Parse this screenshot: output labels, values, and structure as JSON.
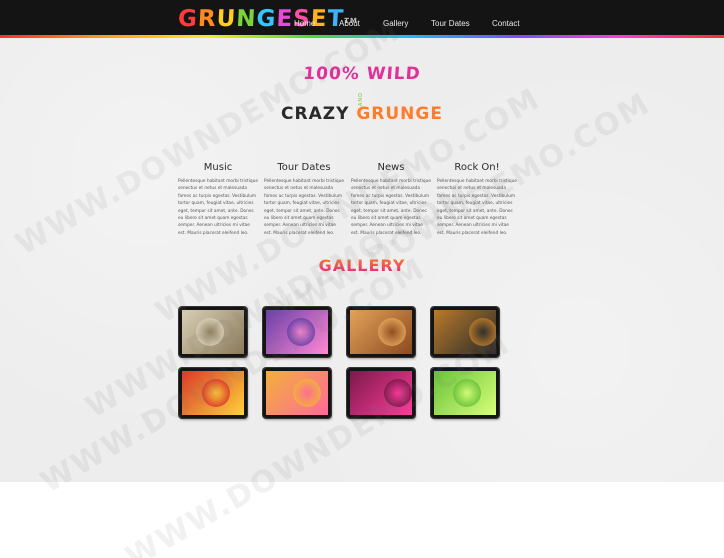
{
  "header": {
    "logo": {
      "letters": [
        {
          "ch": "G",
          "color": "#ff3b3b"
        },
        {
          "ch": "R",
          "color": "#ff8a1f"
        },
        {
          "ch": "U",
          "color": "#ffcf1f"
        },
        {
          "ch": "N",
          "color": "#7bd43a"
        },
        {
          "ch": "G",
          "color": "#35c6ff"
        },
        {
          "ch": "E",
          "color": "#e94ad9"
        },
        {
          "ch": "S",
          "color": "#ff4fa3"
        },
        {
          "ch": "E",
          "color": "#ffb21f"
        },
        {
          "ch": "T",
          "color": "#3db3ff"
        }
      ],
      "mark": "TM"
    },
    "nav": [
      "Home",
      "About",
      "Gallery",
      "Tour Dates",
      "Contact"
    ]
  },
  "hero": {
    "line1": "100% WILD",
    "and": "AND",
    "line2_a": "CRAZY",
    "line2_b": "GRUNGE"
  },
  "columns": [
    {
      "title": "Music",
      "body": "Pellentesque habitant morbi tristique senectus et netus et malesuada fames ac turpis egestas. Vestibulum tortor quam, feugiat vitae, ultricies eget, tempor sit amet, ante. Donec eu libero sit amet quam egestas semper. Aenean ultricies mi vitae est. Mauris placerat eleifend leo."
    },
    {
      "title": "Tour Dates",
      "body": "Pellentesque habitant morbi tristique senectus et netus et malesuada fames ac turpis egestas. Vestibulum tortor quam, feugiat vitae, ultricies eget, tempor sit amet, ante. Donec eu libero sit amet quam egestas semper. Aenean ultricies mi vitae est. Mauris placerat eleifend leo."
    },
    {
      "title": "News",
      "body": "Pellentesque habitant morbi tristique senectus et netus et malesuada fames ac turpis egestas. Vestibulum tortor quam, feugiat vitae, ultricies eget, tempor sit amet, ante. Donec eu libero sit amet quam egestas semper. Aenean ultricies mi vitae est. Mauris placerat eleifend leo."
    },
    {
      "title": "Rock On!",
      "body": "Pellentesque habitant morbi tristique senectus et netus et malesuada fames ac turpis egestas. Vestibulum tortor quam, feugiat vitae, ultricies eget, tempor sit amet, ante. Donec eu libero sit amet quam egestas semper. Aenean ultricies mi vitae est. Mauris placerat eleifend leo."
    }
  ],
  "gallery": {
    "title": "GALLERY",
    "thumbs": [
      {
        "name": "turntable-photo",
        "bg": "#d9cfb6",
        "accent": "#8a7a5a"
      },
      {
        "name": "pink-girl-photo",
        "bg": "#6a3ea8",
        "accent": "#ff8ad4"
      },
      {
        "name": "desert-figure-photo",
        "bg": "#e3a35a",
        "accent": "#8b4a1f"
      },
      {
        "name": "dj-photo",
        "bg": "#b97a2a",
        "accent": "#2a2a2a"
      },
      {
        "name": "skull-art-photo",
        "bg": "#d83a2a",
        "accent": "#ffd23a"
      },
      {
        "name": "butterfly-girl-photo",
        "bg": "#f2b03a",
        "accent": "#ff6a9a"
      },
      {
        "name": "vinyl-art-photo",
        "bg": "#7a1a4a",
        "accent": "#ff3b9a"
      },
      {
        "name": "green-abstract-photo",
        "bg": "#6ac23a",
        "accent": "#d8ff7a"
      }
    ]
  },
  "watermark": "WWW.DOWNDEMO.COM"
}
